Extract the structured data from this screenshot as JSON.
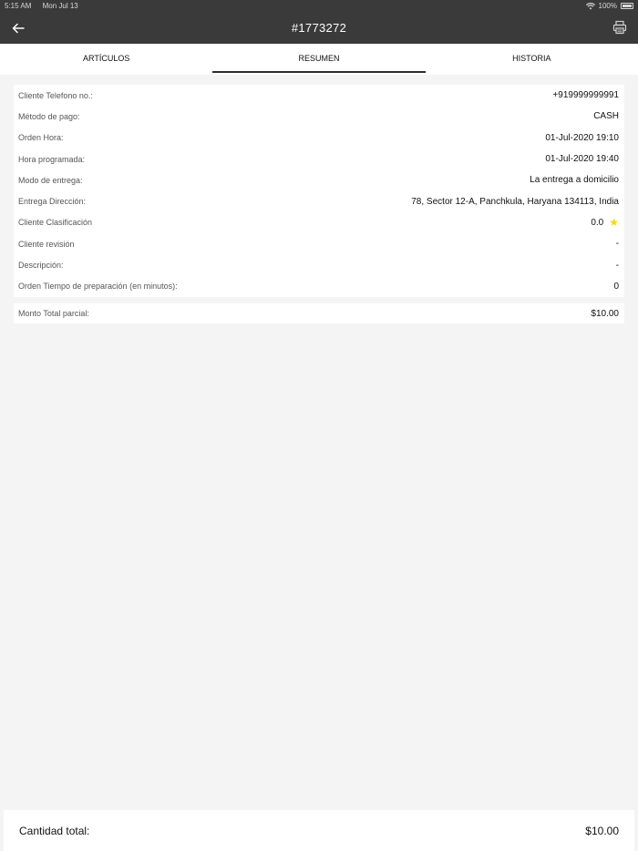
{
  "status_bar": {
    "time": "5:15 AM",
    "date": "Mon Jul 13",
    "battery": "100%"
  },
  "header": {
    "title": "#1773272",
    "back_icon": "arrow-left-icon",
    "print_icon": "printer-icon"
  },
  "tabs": [
    {
      "label": "ARTÍCULOS",
      "active": false
    },
    {
      "label": "RESUMEN",
      "active": true
    },
    {
      "label": "HISTORIA",
      "active": false
    }
  ],
  "details": [
    {
      "label": "Cliente Telefono no.:",
      "value": "+919999999991"
    },
    {
      "label": "Método de pago:",
      "value": "CASH"
    },
    {
      "label": "Orden Hora:",
      "value": "01-Jul-2020 19:10"
    },
    {
      "label": "Hora programada:",
      "value": "01-Jul-2020 19:40"
    },
    {
      "label": "Modo de entrega:",
      "value": "La entrega a domicilio"
    },
    {
      "label": "Entrega Dirección:",
      "value": "78, Sector 12-A, Panchkula, Haryana 134113, India"
    },
    {
      "label": "Cliente Clasificación",
      "value": "0.0"
    },
    {
      "label": "Cliente revisión",
      "value": "-"
    },
    {
      "label": "Descripción:",
      "value": "-"
    },
    {
      "label": "Orden Tiempo de preparación (en minutos):",
      "value": "0"
    }
  ],
  "subtotal": {
    "label": "Monto Total parcial:",
    "value": "$10.00"
  },
  "footer": {
    "label": "Cantidad total:",
    "value": "$10.00"
  },
  "colors": {
    "header_bg": "#3a3a3a",
    "page_bg": "#f4f4f4",
    "star": "#f5d90a"
  }
}
